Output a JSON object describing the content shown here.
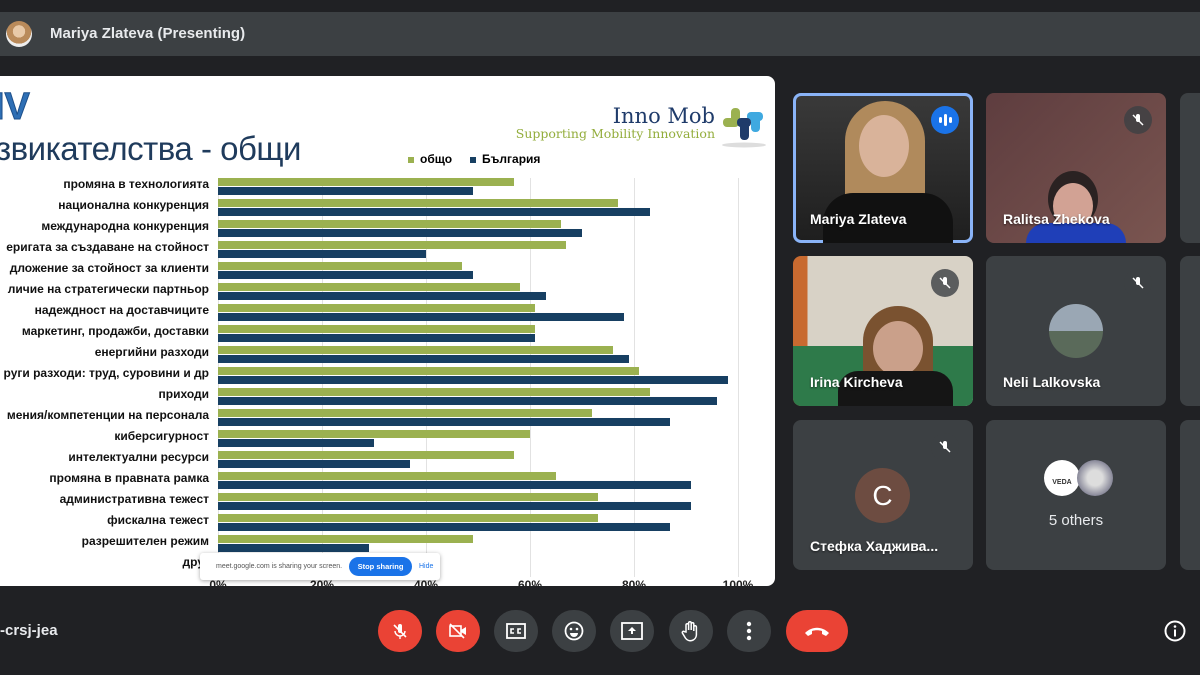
{
  "header": {
    "presenter": "Mariya Zlateva (Presenting)"
  },
  "slide": {
    "title_line1": "IV",
    "title_line2": "звикателства - общи",
    "logo_main": "Inno Mob",
    "logo_sub": "Supporting Mobility Innovation"
  },
  "chart_data": {
    "type": "bar",
    "orientation": "horizontal",
    "categories": [
      "промяна в технологията",
      "национална конкуренция",
      "международна конкуренция",
      "еригата за създаване на стойност",
      "дложение за стойност за клиенти",
      "личие на стратегически партньор",
      "надеждност на доставчиците",
      "маркетинг, продажби, доставки",
      "енергийни разходи",
      "руги разходи: труд, суровини и др",
      "приходи",
      "мения/компетенции на персонала",
      "киберсигурност",
      "интелектуални ресурси",
      "промяна в правната рамка",
      "административна тежест",
      "фискална тежест",
      "разрешителен режим",
      "друг"
    ],
    "series": [
      {
        "name": "общо",
        "color": "#9bb150",
        "values": [
          57,
          77,
          66,
          67,
          47,
          58,
          61,
          61,
          76,
          81,
          83,
          72,
          60,
          57,
          65,
          73,
          73,
          49,
          0
        ]
      },
      {
        "name": "България",
        "color": "#173f62",
        "values": [
          49,
          83,
          70,
          40,
          49,
          63,
          78,
          61,
          79,
          98,
          96,
          87,
          30,
          37,
          91,
          91,
          87,
          29,
          0
        ]
      }
    ],
    "xlim": [
      0,
      100
    ],
    "x_ticks": [
      "0%",
      "20%",
      "40%",
      "60%",
      "80%",
      "100%"
    ],
    "grid": true,
    "legend_position": "top"
  },
  "share_banner": {
    "text": "meet.google.com is sharing your screen.",
    "stop": "Stop sharing",
    "hide": "Hide"
  },
  "participants": [
    {
      "name": "Mariya Zlateva",
      "state": "speaking"
    },
    {
      "name": "Ralitsa Zhekova",
      "state": "muted"
    },
    {
      "name": "Irina Kircheva",
      "state": "muted"
    },
    {
      "name": "Neli Lalkovska",
      "state": "muted"
    },
    {
      "name": "Стефка Хаджива...",
      "state": "muted",
      "initial": "C"
    },
    {
      "name": "5 others",
      "badge": "VEDA"
    }
  ],
  "footer": {
    "meeting_code": "-crsj-jea"
  },
  "colors": {
    "accent": "#1a73e8",
    "danger": "#ea4335",
    "tile": "#3c4043",
    "bg": "#202124"
  }
}
